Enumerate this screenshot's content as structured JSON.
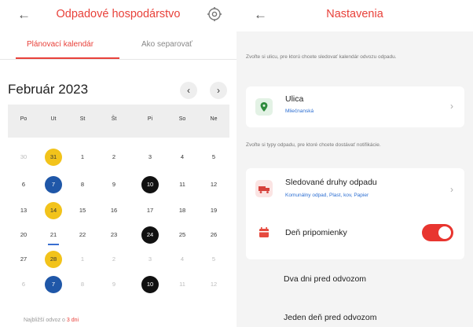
{
  "left": {
    "header": {
      "title": "Odpadové hospodárstvo",
      "back_icon": "arrow-left-icon",
      "settings_icon": "gear-icon"
    },
    "tabs": [
      {
        "label": "Plánovací kalendár",
        "active": true
      },
      {
        "label": "Ako separovať",
        "active": false
      }
    ],
    "calendar": {
      "month": "Február 2023",
      "prev": "‹",
      "next": "›",
      "weekdays": [
        "Po",
        "Ut",
        "St",
        "Št",
        "Pi",
        "So",
        "Ne"
      ],
      "weeks": [
        [
          {
            "d": "30",
            "t": "muted"
          },
          {
            "d": "31",
            "t": "yellow"
          },
          {
            "d": "1",
            "t": "normal"
          },
          {
            "d": "2",
            "t": "normal"
          },
          {
            "d": "3",
            "t": "normal"
          },
          {
            "d": "4",
            "t": "normal"
          },
          {
            "d": "5",
            "t": "normal"
          }
        ],
        [
          {
            "d": "6",
            "t": "normal"
          },
          {
            "d": "7",
            "t": "blue"
          },
          {
            "d": "8",
            "t": "normal"
          },
          {
            "d": "9",
            "t": "normal"
          },
          {
            "d": "10",
            "t": "black"
          },
          {
            "d": "11",
            "t": "normal"
          },
          {
            "d": "12",
            "t": "normal"
          }
        ],
        [
          {
            "d": "13",
            "t": "normal"
          },
          {
            "d": "14",
            "t": "yellow"
          },
          {
            "d": "15",
            "t": "normal"
          },
          {
            "d": "16",
            "t": "normal"
          },
          {
            "d": "17",
            "t": "normal"
          },
          {
            "d": "18",
            "t": "normal"
          },
          {
            "d": "19",
            "t": "normal"
          }
        ],
        [
          {
            "d": "20",
            "t": "normal"
          },
          {
            "d": "21",
            "t": "normal",
            "today": true
          },
          {
            "d": "22",
            "t": "normal"
          },
          {
            "d": "23",
            "t": "normal"
          },
          {
            "d": "24",
            "t": "black"
          },
          {
            "d": "25",
            "t": "normal"
          },
          {
            "d": "26",
            "t": "normal"
          }
        ],
        [
          {
            "d": "27",
            "t": "normal"
          },
          {
            "d": "28",
            "t": "yellow"
          },
          {
            "d": "1",
            "t": "muted"
          },
          {
            "d": "2",
            "t": "muted"
          },
          {
            "d": "3",
            "t": "muted"
          },
          {
            "d": "4",
            "t": "muted"
          },
          {
            "d": "5",
            "t": "muted"
          }
        ],
        [
          {
            "d": "6",
            "t": "muted"
          },
          {
            "d": "7",
            "t": "blue"
          },
          {
            "d": "8",
            "t": "muted"
          },
          {
            "d": "9",
            "t": "muted"
          },
          {
            "d": "10",
            "t": "black"
          },
          {
            "d": "11",
            "t": "muted"
          },
          {
            "d": "12",
            "t": "muted"
          }
        ]
      ]
    },
    "next_pickup": {
      "text": "Najbližší odvoz o",
      "accent": "3 dni"
    }
  },
  "right": {
    "header": {
      "title": "Nastavenia",
      "back_icon": "arrow-left-icon"
    },
    "street_hint": "Zvoľte si ulicu, pre ktorú chcete sledovať kalendár odvozu odpadu.",
    "street": {
      "label": "Ulica",
      "value": "Mlieč­nanská",
      "icon": "map-pin-icon"
    },
    "types_hint": "Zvoľte si typy odpadu, pre ktoré chcete dostávať notifikácie.",
    "types": {
      "label": "Sledované druhy odpadu",
      "value": "Komunálny odpad, Plast, kov, Papier",
      "icon": "truck-icon"
    },
    "reminder": {
      "label": "Deň pripomienky",
      "icon": "calendar-icon",
      "enabled": true
    },
    "options": [
      "Dva dni pred odvozom",
      "Jeden deň pred odvozom"
    ]
  },
  "colors": {
    "accent": "#e8413a",
    "yellow": "#f2c31b",
    "blue": "#1f57a8",
    "black": "#111111",
    "link": "#2d6fd2"
  }
}
